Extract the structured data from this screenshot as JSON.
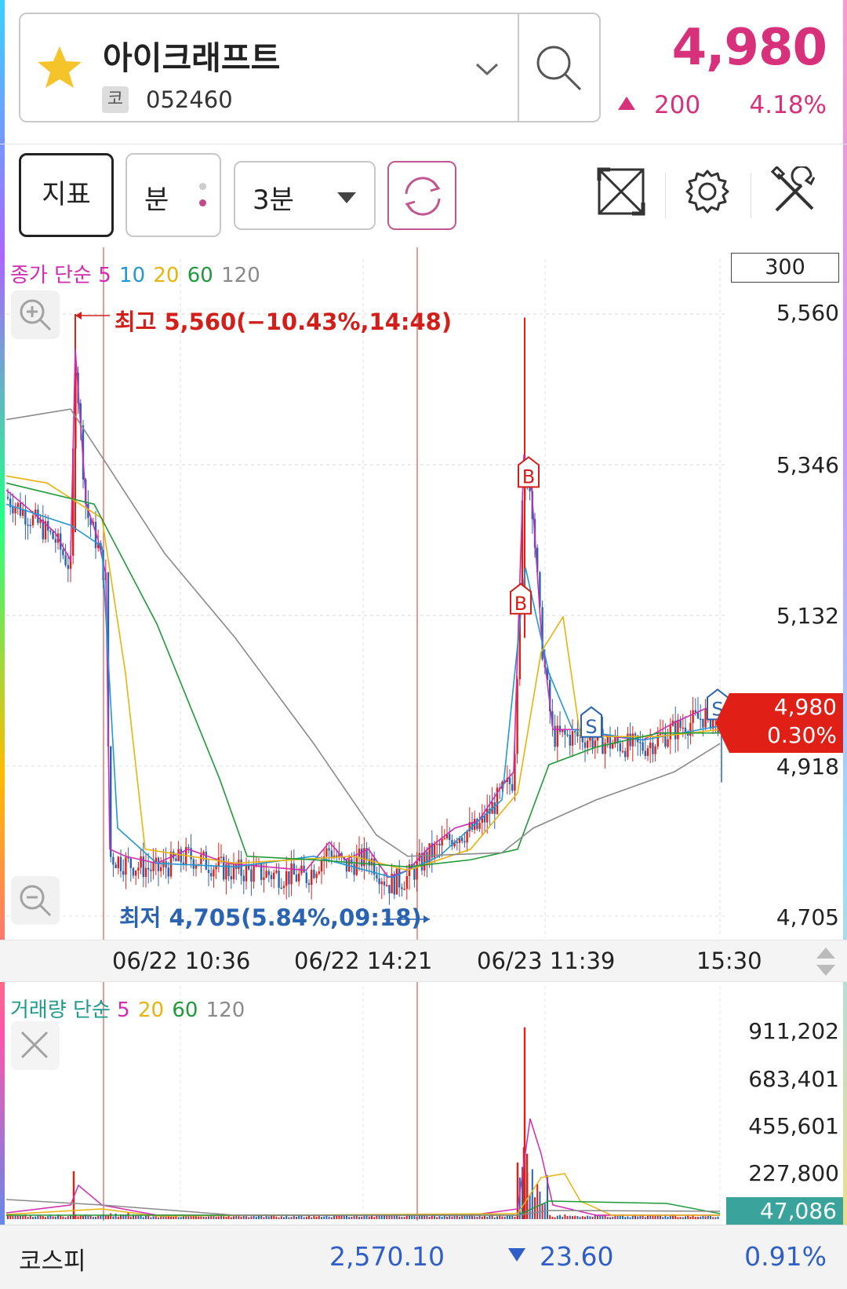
{
  "stock": {
    "name": "아이크래프트",
    "market_badge": "코",
    "code": "052460",
    "price": "4,980",
    "change": "200",
    "change_pct": "4.18%",
    "change_direction": "up"
  },
  "toolbar": {
    "indicator_label": "지표",
    "period_unit_label": "분",
    "interval_value": "3분"
  },
  "chart": {
    "ma_legend": {
      "prefix": "종가 단순",
      "periods": [
        "5",
        "10",
        "20",
        "60",
        "120"
      ],
      "colors": [
        "#d12bb0",
        "#1f98d3",
        "#e8b30c",
        "#1e9a3a",
        "#8a8a8a"
      ]
    },
    "candle_count": "300",
    "y_ticks": [
      "5,560",
      "5,346",
      "5,132",
      "4,918",
      "4,705"
    ],
    "x_ticks": [
      "06/22 10:36",
      "06/22 14:21",
      "06/23 11:39",
      "15:30"
    ],
    "high_annotation": "최고 5,560(−10.43%,14:48)",
    "low_annotation": "최저 4,705(5.84%,09:18)",
    "current_price_tag": "4,980",
    "current_pct_tag": "0.30%",
    "signals": [
      "B",
      "B",
      "S",
      "S"
    ],
    "up_color": "#e02016",
    "down_color": "#2a63b0"
  },
  "volume": {
    "legend": {
      "prefix": "거래량 단순",
      "periods": [
        "5",
        "20",
        "60",
        "120"
      ],
      "colors": [
        "#d12bb0",
        "#e8b30c",
        "#1e9a3a",
        "#8a8a8a"
      ]
    },
    "y_ticks": [
      "911,202",
      "683,401",
      "455,601",
      "227,800"
    ],
    "current_tag": "47,086"
  },
  "footer": {
    "index_name": "코스피",
    "index_value": "2,570.10",
    "index_change": "23.60",
    "index_pct": "0.91%",
    "direction": "down"
  },
  "chart_data": {
    "type": "candlestick",
    "title": "",
    "ylim": [
      4705,
      5560
    ],
    "interval": "3분",
    "moving_averages": [
      "5",
      "10",
      "20",
      "60",
      "120"
    ],
    "series": [
      {
        "name": "5",
        "values": [
          5300,
          5260,
          5240,
          5500,
          5200,
          4780,
          4760,
          4770,
          4780,
          4790,
          4760,
          4860,
          4790,
          4740,
          4760,
          4800,
          4830,
          4880,
          4930,
          5300,
          5150,
          4990,
          4960,
          4970,
          4950,
          4990,
          4990
        ]
      },
      {
        "name": "120",
        "values": [
          5400,
          5410,
          5420,
          5440,
          5350,
          5210,
          5080,
          4950,
          4840,
          4790,
          4790,
          4790,
          4800,
          4810,
          4860,
          4880,
          4900,
          4920,
          4950
        ]
      }
    ],
    "high": {
      "value": 5560,
      "change_pct": "-10.43%",
      "time": "14:48"
    },
    "low": {
      "value": 4705,
      "change_pct": "5.84%",
      "time": "09:18"
    },
    "last": {
      "value": 4980,
      "pct": "0.30%"
    },
    "volume_ylim": [
      0,
      911202
    ],
    "volume_last": 47086
  }
}
